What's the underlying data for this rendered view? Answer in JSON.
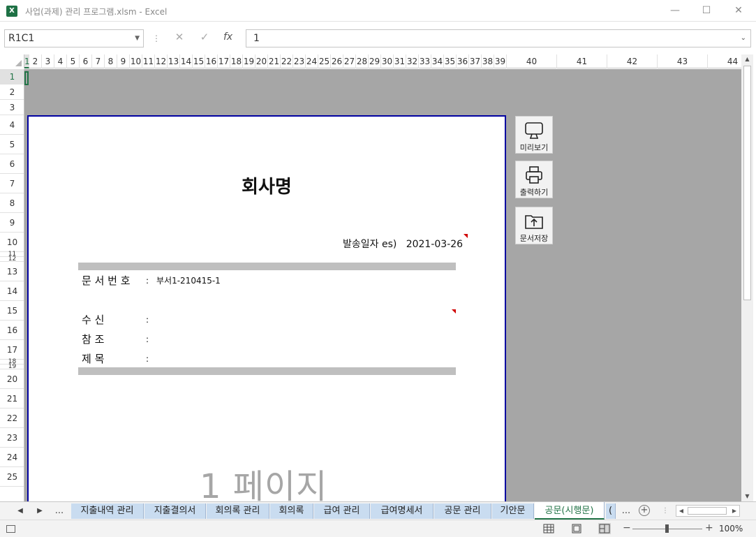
{
  "window": {
    "title": "사업(과제) 관리 프로그램.xlsm  -  Excel",
    "app_icon": "X",
    "minimize": "—",
    "maximize": "☐",
    "close": "✕"
  },
  "formula_bar": {
    "name_box": "R1C1",
    "cancel_icon": "✕",
    "enter_icon": "✓",
    "fx_label": "fx",
    "content": "1"
  },
  "columns": [
    "1",
    "2",
    "3",
    "4",
    "5",
    "6",
    "7",
    "8",
    "9",
    "10",
    "11",
    "12",
    "13",
    "14",
    "15",
    "16",
    "17",
    "18",
    "19",
    "20",
    "21",
    "22",
    "23",
    "24",
    "25",
    "26",
    "27",
    "28",
    "29",
    "30",
    "31",
    "32",
    "33",
    "34",
    "35",
    "36",
    "37",
    "38",
    "39",
    "40",
    "41",
    "42",
    "43",
    "44"
  ],
  "rows": [
    "1",
    "2",
    "3",
    "4",
    "5",
    "6",
    "7",
    "8",
    "9",
    "10",
    "11",
    "12",
    "13",
    "14",
    "15",
    "16",
    "17",
    "18",
    "19",
    "20",
    "21",
    "22",
    "23",
    "24",
    "25"
  ],
  "document": {
    "company_name": "회사명",
    "send_date_label": "발송일자 es)",
    "send_date": "2021-03-26",
    "doc_number_label": "문 서 번 호",
    "doc_number_colon": ":",
    "doc_number_value": "부서1-210415-1",
    "recipient_label": "수         신",
    "recipient_colon": ":",
    "reference_label": "참         조",
    "reference_colon": ":",
    "subject_label": "제         목",
    "subject_colon": ":",
    "page_watermark": "1 페이지"
  },
  "side_buttons": {
    "preview": "미리보기",
    "print": "출력하기",
    "save_doc": "문서저장"
  },
  "sheet_tabs": {
    "nav_prev": "◀",
    "nav_next": "▶",
    "overflow_left": "...",
    "tabs": [
      "지출내역 관리",
      "지출결의서",
      "회의록 관리",
      "회의록",
      "급여 관리",
      "급여명세서",
      "공문 관리",
      "기안문",
      "공문(시행문)"
    ],
    "partial_tab": "(",
    "overflow_right": "...",
    "add": "+"
  },
  "status": {
    "zoom_minus": "−",
    "zoom_plus": "+",
    "zoom_level": "100%",
    "zoom_fraction": 0.5
  }
}
